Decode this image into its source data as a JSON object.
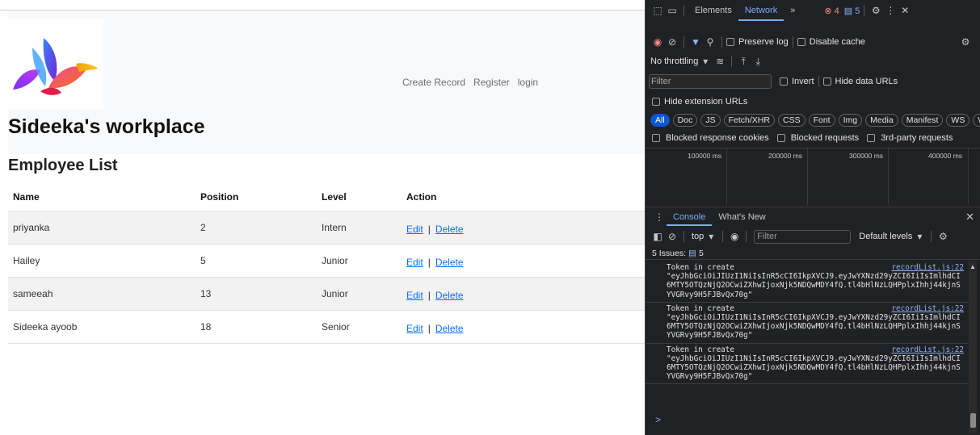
{
  "site": {
    "title": "Sideeka's workplace",
    "nav": [
      "Create Record",
      "Register",
      "login"
    ]
  },
  "employees": {
    "heading": "Employee List",
    "columns": [
      "Name",
      "Position",
      "Level",
      "Action"
    ],
    "rows": [
      {
        "name": "priyanka",
        "position": "2",
        "level": "Intern"
      },
      {
        "name": "Hailey",
        "position": "5",
        "level": "Junior"
      },
      {
        "name": "sameeah",
        "position": "13",
        "level": "Junior"
      },
      {
        "name": "Sideeka ayoob",
        "position": "18",
        "level": "Senior"
      }
    ],
    "edit_label": "Edit",
    "delete_label": "Delete",
    "separator": "|"
  },
  "devtools": {
    "tabs": [
      "Elements",
      "Network"
    ],
    "active_tab": "Network",
    "more_tabs": "»",
    "error_count": "4",
    "message_count": "5",
    "network": {
      "preserve_log": "Preserve log",
      "disable_cache": "Disable cache",
      "throttling": "No throttling",
      "filter_placeholder": "Filter",
      "invert": "Invert",
      "hide_data_urls": "Hide data URLs",
      "hide_extension_urls": "Hide extension URLs",
      "type_filters": [
        "All",
        "Doc",
        "JS",
        "Fetch/XHR",
        "CSS",
        "Font",
        "Img",
        "Media",
        "Manifest",
        "WS",
        "Wasm"
      ],
      "active_type": "All",
      "blocked_response_cookies": "Blocked response cookies",
      "blocked_requests": "Blocked requests",
      "third_party": "3rd-party requests",
      "timeline_ticks": [
        "100000 ms",
        "200000 ms",
        "300000 ms",
        "400000 ms"
      ]
    },
    "console": {
      "tabs": [
        "Console",
        "What's New"
      ],
      "context": "top",
      "filter_placeholder": "Filter",
      "levels": "Default levels",
      "issues_label": "5 Issues:",
      "issues_count": "5",
      "logs": [
        {
          "message": "Token in create",
          "source": "recordList.js:22",
          "value": "\"eyJhbGciOiJIUzI1NiIsInR5cCI6IkpXVCJ9.eyJwYXNzd29yZCI6IiIsImlhdCI6MTY5OTQzNjQ2OCwiZXhwIjoxNjk5NDQwMDY4fQ.tl4bHlNzLQHPplxIhhj44kjnSYVGRvy9H5FJBvQx70g\""
        },
        {
          "message": "Token in create",
          "source": "recordList.js:22",
          "value": "\"eyJhbGciOiJIUzI1NiIsInR5cCI6IkpXVCJ9.eyJwYXNzd29yZCI6IiIsImlhdCI6MTY5OTQzNjQ2OCwiZXhwIjoxNjk5NDQwMDY4fQ.tl4bHlNzLQHPplxIhhj44kjnSYVGRvy9H5FJBvQx70g\""
        },
        {
          "message": "Token in create",
          "source": "recordList.js:22",
          "value": "\"eyJhbGciOiJIUzI1NiIsInR5cCI6IkpXVCJ9.eyJwYXNzd29yZCI6IiIsImlhdCI6MTY5OTQzNjQ2OCwiZXhwIjoxNjk5NDQwMDY4fQ.tl4bHlNzLQHPplxIhhj44kjnSYVGRvy9H5FJBvQx70g\""
        }
      ],
      "prompt": ">"
    }
  },
  "colors": {
    "link": "#0d6efd",
    "devtools_bg": "#202124",
    "devtools_accent": "#7cacf8",
    "error": "#f28b82"
  }
}
